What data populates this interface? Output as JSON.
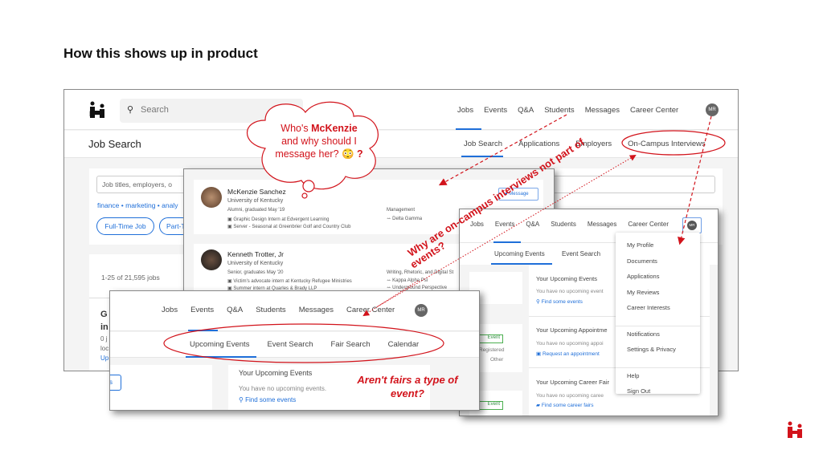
{
  "slide_title": "How this shows up in product",
  "main": {
    "search_placeholder": "Search",
    "nav": [
      "Jobs",
      "Events",
      "Q&A",
      "Students",
      "Messages",
      "Career Center"
    ],
    "avatar": "MR",
    "page_title": "Job Search",
    "subnav": [
      "Job Search",
      "Applications",
      "Employers",
      "On-Campus Interviews"
    ],
    "job_search_placeholder": "Job titles, employers, o",
    "keywords": "finance • marketing • analy",
    "filters": [
      "Full-Time Job",
      "Part-T"
    ],
    "result_count": "1-25 of 21,595 jobs",
    "partial_lines": [
      "G",
      "in",
      "0 j",
      "loc",
      "Up"
    ]
  },
  "students": [
    {
      "name": "McKenzie Sanchez",
      "school": "University of Kentucky",
      "status": "Alumni, graduated May '19",
      "major": "Management",
      "jobs": [
        "Graphic Design Intern at Edvergent Learning",
        "Server - Seasonal at Greenbrier Golf and Country Club"
      ],
      "orgs": [
        "Delta Gamma"
      ],
      "button": "Message"
    },
    {
      "name": "Kenneth Trotter, Jr",
      "school": "University of Kentucky",
      "status": "Senior, graduates May '20",
      "major": "Writing, Rhetoric, and Digital St",
      "jobs": [
        "Victim's advocate intern at Kentucky Refugee Ministries",
        "Summer intern at Quarles & Brady LLP"
      ],
      "orgs": [
        "Kappa Alpha Psi",
        "Underground Perspective"
      ]
    }
  ],
  "events_panel": {
    "nav": [
      "Jobs",
      "Events",
      "Q&A",
      "Students",
      "Messages",
      "Career Center"
    ],
    "avatar": "MR",
    "subnav": [
      "Upcoming Events",
      "Event Search"
    ],
    "sections": [
      {
        "title": "Your Upcoming Events",
        "empty": "You have no upcoming event",
        "link": "Find some events"
      },
      {
        "title": "Your Upcoming Appointme",
        "empty": "You have no upcoming appoi",
        "link": "Request an appointment"
      },
      {
        "title": "Your Upcoming Career Fair",
        "empty": "You have no upcoming caree",
        "link": "Find some career fairs"
      }
    ],
    "badges": [
      "Event",
      "Event"
    ],
    "side_text": [
      "Registered",
      "Other"
    ],
    "menu": [
      [
        "My Profile",
        "Documents",
        "Applications",
        "My Reviews",
        "Career Interests"
      ],
      [
        "Notifications",
        "Settings & Privacy"
      ],
      [
        "Help",
        "Sign Out"
      ]
    ]
  },
  "bottom_panel": {
    "nav": [
      "Jobs",
      "Events",
      "Q&A",
      "Students",
      "Messages",
      "Career Center"
    ],
    "avatar": "MR",
    "subnav": [
      "Upcoming Events",
      "Event Search",
      "Fair Search",
      "Calendar"
    ],
    "section_title": "Your Upcoming Events",
    "empty": "You have no upcoming events.",
    "link": "Find some events",
    "left_btn": "s"
  },
  "annotations": {
    "cloud": [
      "Who's ",
      "McKenzie",
      "and why should I",
      "message her? 😳",
      "?"
    ],
    "diagonal": [
      "Why are on-campus interviews not part of",
      "events?"
    ],
    "fairs": [
      "Aren't fairs a type of",
      "event?"
    ]
  },
  "colors": {
    "accent": "#1f6fd9",
    "annotation": "#d2131b",
    "brand": "#d2131b"
  }
}
